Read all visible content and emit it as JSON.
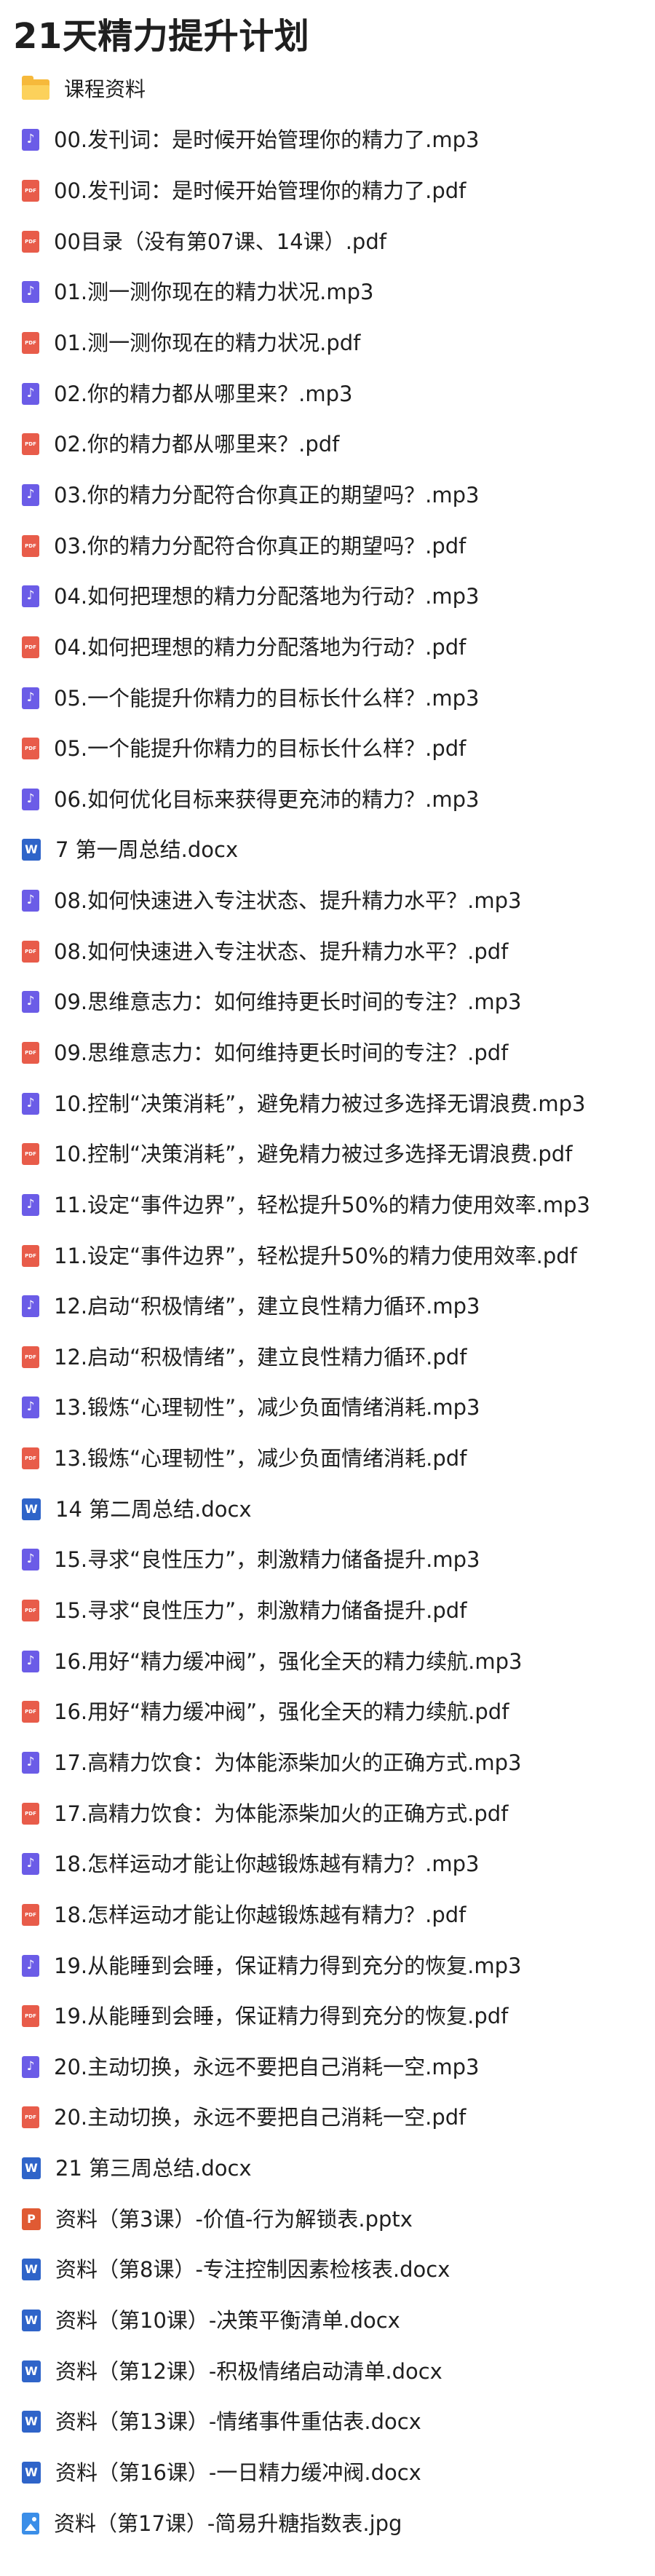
{
  "title": "21天精力提升计划",
  "folder": {
    "label": "课程资料",
    "icon": "folder-icon"
  },
  "files": [
    {
      "name": "00.发刊词：是时候开始管理你的精力了.mp3",
      "type": "mp3",
      "icon": "audio-file-icon"
    },
    {
      "name": "00.发刊词：是时候开始管理你的精力了.pdf",
      "type": "pdf",
      "icon": "pdf-file-icon"
    },
    {
      "name": "00目录（没有第07课、14课）.pdf",
      "type": "pdf",
      "icon": "pdf-file-icon"
    },
    {
      "name": "01.测一测你现在的精力状况.mp3",
      "type": "mp3",
      "icon": "audio-file-icon"
    },
    {
      "name": "01.测一测你现在的精力状况.pdf",
      "type": "pdf",
      "icon": "pdf-file-icon"
    },
    {
      "name": "02.你的精力都从哪里来？.mp3",
      "type": "mp3",
      "icon": "audio-file-icon"
    },
    {
      "name": "02.你的精力都从哪里来？.pdf",
      "type": "pdf",
      "icon": "pdf-file-icon"
    },
    {
      "name": "03.你的精力分配符合你真正的期望吗？.mp3",
      "type": "mp3",
      "icon": "audio-file-icon"
    },
    {
      "name": "03.你的精力分配符合你真正的期望吗？.pdf",
      "type": "pdf",
      "icon": "pdf-file-icon"
    },
    {
      "name": "04.如何把理想的精力分配落地为行动？.mp3",
      "type": "mp3",
      "icon": "audio-file-icon"
    },
    {
      "name": "04.如何把理想的精力分配落地为行动？.pdf",
      "type": "pdf",
      "icon": "pdf-file-icon"
    },
    {
      "name": "05.一个能提升你精力的目标长什么样？.mp3",
      "type": "mp3",
      "icon": "audio-file-icon"
    },
    {
      "name": "05.一个能提升你精力的目标长什么样？.pdf",
      "type": "pdf",
      "icon": "pdf-file-icon"
    },
    {
      "name": "06.如何优化目标来获得更充沛的精力？.mp3",
      "type": "mp3",
      "icon": "audio-file-icon"
    },
    {
      "name": "7 第一周总结.docx",
      "type": "docx",
      "icon": "word-file-icon"
    },
    {
      "name": "08.如何快速进入专注状态、提升精力水平？.mp3",
      "type": "mp3",
      "icon": "audio-file-icon"
    },
    {
      "name": "08.如何快速进入专注状态、提升精力水平？.pdf",
      "type": "pdf",
      "icon": "pdf-file-icon"
    },
    {
      "name": "09.思维意志力：如何维持更长时间的专注？.mp3",
      "type": "mp3",
      "icon": "audio-file-icon"
    },
    {
      "name": "09.思维意志力：如何维持更长时间的专注？.pdf",
      "type": "pdf",
      "icon": "pdf-file-icon"
    },
    {
      "name": "10.控制“决策消耗”，避免精力被过多选择无谓浪费.mp3",
      "type": "mp3",
      "icon": "audio-file-icon"
    },
    {
      "name": "10.控制“决策消耗”，避免精力被过多选择无谓浪费.pdf",
      "type": "pdf",
      "icon": "pdf-file-icon"
    },
    {
      "name": "11.设定“事件边界”，轻松提升50%的精力使用效率.mp3",
      "type": "mp3",
      "icon": "audio-file-icon"
    },
    {
      "name": "11.设定“事件边界”，轻松提升50%的精力使用效率.pdf",
      "type": "pdf",
      "icon": "pdf-file-icon"
    },
    {
      "name": "12.启动“积极情绪”，建立良性精力循环.mp3",
      "type": "mp3",
      "icon": "audio-file-icon"
    },
    {
      "name": "12.启动“积极情绪”，建立良性精力循环.pdf",
      "type": "pdf",
      "icon": "pdf-file-icon"
    },
    {
      "name": "13.锻炼“心理韧性”，减少负面情绪消耗.mp3",
      "type": "mp3",
      "icon": "audio-file-icon"
    },
    {
      "name": "13.锻炼“心理韧性”，减少负面情绪消耗.pdf",
      "type": "pdf",
      "icon": "pdf-file-icon"
    },
    {
      "name": "14 第二周总结.docx",
      "type": "docx",
      "icon": "word-file-icon"
    },
    {
      "name": "15.寻求“良性压力”，刺激精力储备提升.mp3",
      "type": "mp3",
      "icon": "audio-file-icon"
    },
    {
      "name": "15.寻求“良性压力”，刺激精力储备提升.pdf",
      "type": "pdf",
      "icon": "pdf-file-icon"
    },
    {
      "name": "16.用好“精力缓冲阀”，强化全天的精力续航.mp3",
      "type": "mp3",
      "icon": "audio-file-icon"
    },
    {
      "name": "16.用好“精力缓冲阀”，强化全天的精力续航.pdf",
      "type": "pdf",
      "icon": "pdf-file-icon"
    },
    {
      "name": "17.高精力饮食：为体能添柴加火的正确方式.mp3",
      "type": "mp3",
      "icon": "audio-file-icon"
    },
    {
      "name": "17.高精力饮食：为体能添柴加火的正确方式.pdf",
      "type": "pdf",
      "icon": "pdf-file-icon"
    },
    {
      "name": "18.怎样运动才能让你越锻炼越有精力？.mp3",
      "type": "mp3",
      "icon": "audio-file-icon"
    },
    {
      "name": "18.怎样运动才能让你越锻炼越有精力？.pdf",
      "type": "pdf",
      "icon": "pdf-file-icon"
    },
    {
      "name": "19.从能睡到会睡，保证精力得到充分的恢复.mp3",
      "type": "mp3",
      "icon": "audio-file-icon"
    },
    {
      "name": "19.从能睡到会睡，保证精力得到充分的恢复.pdf",
      "type": "pdf",
      "icon": "pdf-file-icon"
    },
    {
      "name": "20.主动切换，永远不要把自己消耗一空.mp3",
      "type": "mp3",
      "icon": "audio-file-icon"
    },
    {
      "name": "20.主动切换，永远不要把自己消耗一空.pdf",
      "type": "pdf",
      "icon": "pdf-file-icon"
    },
    {
      "name": "21 第三周总结.docx",
      "type": "docx",
      "icon": "word-file-icon"
    },
    {
      "name": "资料（第3课）-价值-行为解锁表.pptx",
      "type": "pptx",
      "icon": "powerpoint-file-icon"
    },
    {
      "name": "资料（第8课）-专注控制因素检核表.docx",
      "type": "docx",
      "icon": "word-file-icon"
    },
    {
      "name": "资料（第10课）-决策平衡清单.docx",
      "type": "docx",
      "icon": "word-file-icon"
    },
    {
      "name": "资料（第12课）-积极情绪启动清单.docx",
      "type": "docx",
      "icon": "word-file-icon"
    },
    {
      "name": "资料（第13课）-情绪事件重估表.docx",
      "type": "docx",
      "icon": "word-file-icon"
    },
    {
      "name": "资料（第16课）-一日精力缓冲阀.docx",
      "type": "docx",
      "icon": "word-file-icon"
    },
    {
      "name": "资料（第17课）-简易升糖指数表.jpg",
      "type": "jpg",
      "icon": "image-file-icon"
    }
  ]
}
